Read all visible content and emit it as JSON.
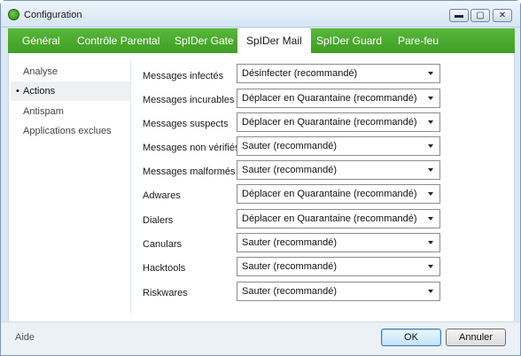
{
  "window": {
    "title": "Configuration",
    "buttons": {
      "minimize": "▬",
      "maximize": "▢",
      "close": "✕"
    }
  },
  "tabs": [
    {
      "label": "Général",
      "active": false
    },
    {
      "label": "Contrôle Parental",
      "active": false
    },
    {
      "label": "SpIDer Gate",
      "active": false
    },
    {
      "label": "SpIDer Mail",
      "active": true
    },
    {
      "label": "SpIDer Guard",
      "active": false
    },
    {
      "label": "Pare-feu",
      "active": false
    }
  ],
  "sidebar": {
    "bullet": "•",
    "items": [
      {
        "label": "Analyse",
        "active": false
      },
      {
        "label": "Actions",
        "active": true
      },
      {
        "label": "Antispam",
        "active": false
      },
      {
        "label": "Applications exclues",
        "active": false
      }
    ]
  },
  "actions": [
    {
      "label": "Messages infectés",
      "value": "Désinfecter (recommandé)"
    },
    {
      "label": "Messages incurables",
      "value": "Déplacer en Quarantaine (recommandé)"
    },
    {
      "label": "Messages suspects",
      "value": "Déplacer en Quarantaine (recommandé)"
    },
    {
      "label": "Messages non vérifiés",
      "value": "Sauter (recommandé)"
    },
    {
      "label": "Messages malformés",
      "value": "Sauter (recommandé)"
    },
    {
      "label": "Adwares",
      "value": "Déplacer en Quarantaine (recommandé)"
    },
    {
      "label": "Dialers",
      "value": "Déplacer en Quarantaine (recommandé)"
    },
    {
      "label": "Canulars",
      "value": "Sauter (recommandé)"
    },
    {
      "label": "Hacktools",
      "value": "Sauter (recommandé)"
    },
    {
      "label": "Riskwares",
      "value": "Sauter (recommandé)"
    }
  ],
  "footer": {
    "help": "Aide",
    "ok": "OK",
    "cancel": "Annuler"
  },
  "colors": {
    "tab_bar": "#4aaa2e",
    "active_tab": "#ffffff",
    "titlebar": "#dbe8f5"
  }
}
